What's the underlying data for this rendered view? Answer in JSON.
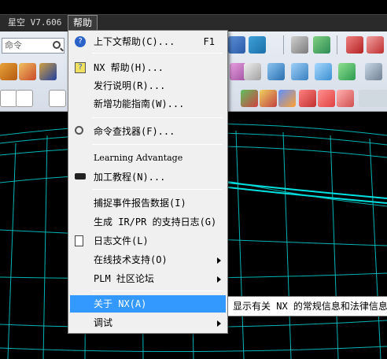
{
  "menubar": {
    "app_label": "星空 V7.606",
    "help_label": "帮助"
  },
  "search": {
    "placeholder": "命令"
  },
  "help_menu": {
    "items": [
      {
        "label": "上下文帮助(C)...",
        "shortcut": "F1",
        "icon": "help-question-icon"
      },
      {
        "label": "NX 帮助(H)...",
        "icon": "help-book-icon"
      },
      {
        "label": "发行说明(R)..."
      },
      {
        "label": "新增功能指南(W)..."
      },
      {
        "label": "命令查找器(F)...",
        "icon": "magnifier-icon"
      },
      {
        "label": "Learning Advantage"
      },
      {
        "label": "加工教程(N)...",
        "icon": "graduation-cap-icon"
      },
      {
        "label": "捕捉事件报告数据(I)"
      },
      {
        "label": "生成 IR/PR 的支持日志(G)"
      },
      {
        "label": "日志文件(L)",
        "icon": "document-icon"
      },
      {
        "label": "在线技术支持(O)",
        "submenu": true
      },
      {
        "label": "PLM 社区论坛",
        "submenu": true
      },
      {
        "label": "关于 NX(A)",
        "highlighted": true
      },
      {
        "label": "调试",
        "submenu": true
      }
    ]
  },
  "tooltip": {
    "text": "显示有关 NX 的常规信息和法律信息。"
  },
  "colors": {
    "menu_highlight": "#3399ff",
    "viewport_bg": "#000000",
    "wireframe": "#00c8c8"
  }
}
